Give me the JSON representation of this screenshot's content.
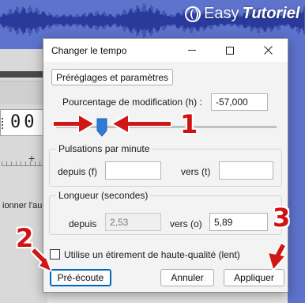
{
  "background": {
    "logo": {
      "part_a": "Easy",
      "part_b": "Tutoriel"
    },
    "time_display": "00",
    "status_text": "ionner l'au"
  },
  "dialog": {
    "title": "Changer le tempo",
    "presets_button": "Préréglages et paramètres",
    "percent_change": {
      "label": "Pourcentage de modification (h) :",
      "value": "-57,000"
    },
    "slider": {
      "value_percent": -57.0
    },
    "beats_per_minute": {
      "group_label": "Pulsations par minute",
      "from_label": "depuis (f)",
      "from_value": "",
      "to_label": "vers (t)",
      "to_value": ""
    },
    "length": {
      "group_label": "Longueur (secondes)",
      "from_label": "depuis",
      "from_value": "2,53",
      "to_label": "vers (o)",
      "to_value": "5,89"
    },
    "high_quality": {
      "label": "Utilise un étirement de haute-qualité (lent)",
      "checked": false
    },
    "buttons": {
      "preview": "Pré-écoute",
      "cancel": "Annuler",
      "apply": "Appliquer"
    }
  },
  "annotations": {
    "one": "1",
    "two": "2",
    "three": "3"
  },
  "colors": {
    "annotation_red": "#d11212",
    "waveform_bg": "#5d73cc",
    "slider_thumb": "#2e7bd6",
    "focus_blue": "#0067c0"
  }
}
